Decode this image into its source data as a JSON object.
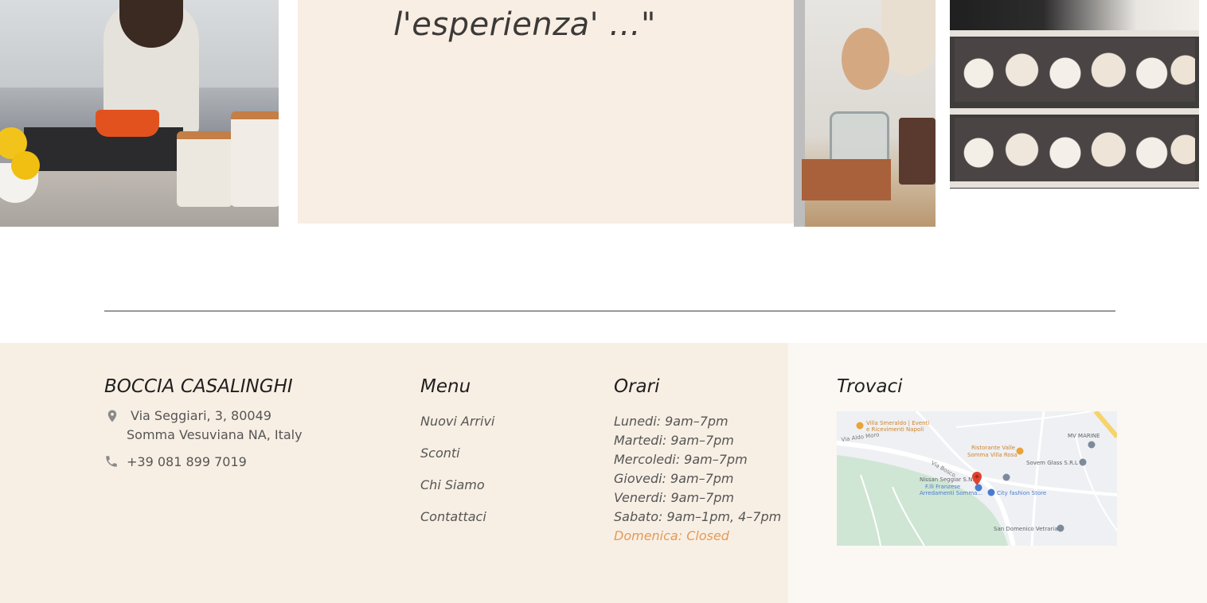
{
  "gallery": {
    "quote": "l'esperienza' ...\""
  },
  "footer": {
    "brand": {
      "title": "BOCCIA CASALINGHI",
      "address_line1": "Via Seggiari, 3, 80049",
      "address_line2": "Somma Vesuviana NA, Italy",
      "phone": "+39 081 899 7019",
      "address_icon": "map-pin-icon",
      "phone_icon": "phone-icon"
    },
    "menu": {
      "title": "Menu",
      "items": [
        "Nuovi Arrivi",
        "Sconti",
        "Chi Siamo",
        "Contattaci"
      ]
    },
    "hours": {
      "title": "Orari",
      "lines": [
        "Lunedi: 9am–7pm",
        "Martedi: 9am–7pm",
        "Mercoledi: 9am–7pm",
        "Giovedi: 9am–7pm",
        "Venerdi: 9am–7pm",
        "Sabato: 9am–1pm, 4–7pm",
        "Domenica: Closed"
      ],
      "closed_color": "#e39a57"
    },
    "find": {
      "title": "Trovaci",
      "map_labels": {
        "villa_smeraldo_1": "Villa Smeraldo | Eventi",
        "villa_smeraldo_2": "e Ricevimenti Napoli",
        "mv_marine": "MV MARINE",
        "ristorante_1": "Ristorante Valle",
        "ristorante_2": "Somma Villa Rosa",
        "sovem": "Sovem Glass S.R.L",
        "nissan": "Nissan Seggiar S.N.C",
        "franzese_1": "F.lli Franzese",
        "franzese_2": "Arredamenti Somma...",
        "city_fashion": "City fashion Store",
        "san_domenico": "San Domenico Vetraria",
        "via_aldo_moro": "Via Aldo Moro",
        "via_bosco": "Via Bosco"
      }
    }
  },
  "colors": {
    "quote_bg": "#f8eee3",
    "footer_bg": "#f8efe4",
    "footer_right_bg": "#fbf8f3",
    "accent": "#e39a57"
  }
}
